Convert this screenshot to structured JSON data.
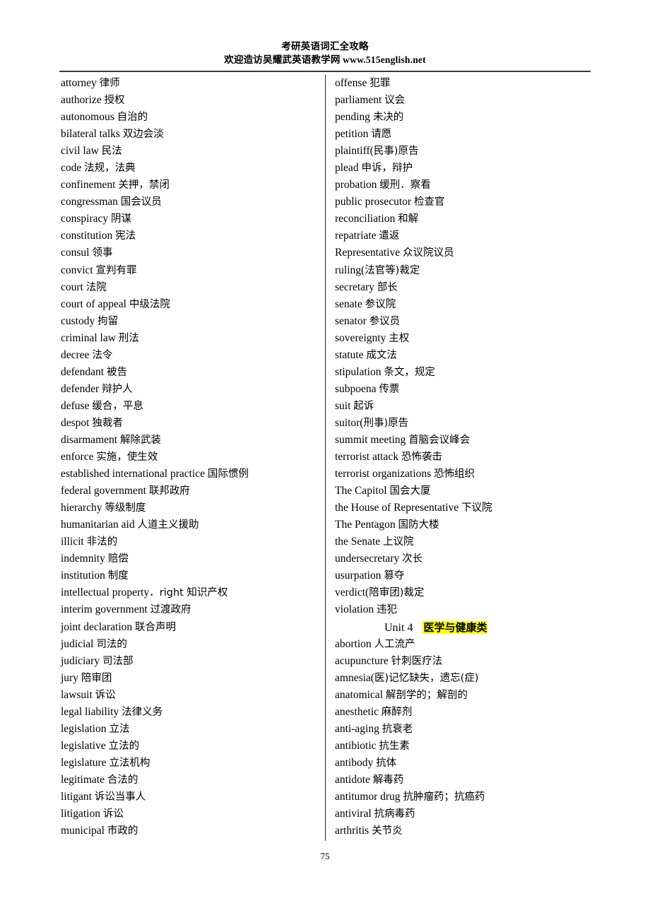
{
  "header": {
    "title_line1": "考研英语词汇全攻略",
    "title_line2": "欢迎造访吴耀武英语教学网 www.515english.net"
  },
  "footer": {
    "page_number": "75"
  },
  "unit_heading": {
    "label": "Unit 4",
    "topic": "医学与健康类",
    "highlight_color": "#ffff00"
  },
  "left_column": {
    "entries": [
      "attorney 律师",
      "authorize 授权",
      "autonomous 自治的",
      "bilateral talks 双边会淡",
      "civil law 民法",
      "code 法规，法典",
      "confinement 关押，禁闭",
      "congressman 国会议员",
      "conspiracy 阴谋",
      "constitution 宪法",
      "consul 领事",
      "convict 宣判有罪",
      "court 法院",
      "court of appeal 中级法院",
      "custody 拘留",
      "criminal law 刑法",
      "decree 法令",
      "defendant 被告",
      "defender 辩护人",
      "defuse 缓合，平息",
      "despot 独裁者",
      "disarmament 解除武装",
      "enforce 实施，使生效",
      "established international practice 国际惯例",
      "federal government 联邦政府",
      "hierarchy 等级制度",
      "humanitarian aid 人道主义援助",
      "illicit 非法的",
      "indemnity 赔偿",
      "institution 制度",
      "intellectual property．right 知识产权",
      "interim government 过渡政府",
      "joint declaration 联合声明",
      "judicial 司法的",
      "judiciary 司法部",
      "jury 陪审团",
      "lawsuit 诉讼",
      "legal liability 法律义务",
      "legislation 立法",
      "legislative 立法的",
      "legislature 立法机构",
      "legitimate 合法的",
      "litigant 诉讼当事人",
      "litigation 诉讼",
      "municipal 市政的"
    ]
  },
  "right_column": {
    "entries_before_unit": [
      "offense 犯罪",
      "parliament 议会",
      "pending 未决的",
      "petition 请愿",
      "plaintiff(民事)原告",
      "plead 申诉，辩护",
      "probation 缓刑．察看",
      "public prosecutor 检查官",
      "reconciliation 和解",
      "repatriate 遣返",
      "Representative 众议院议员",
      "ruling(法官等)裁定",
      "secretary 部长",
      "senate 参议院",
      "senator 参议员",
      "sovereignty 主权",
      "statute 成文法",
      "stipulation 条文，规定",
      "subpoena 传票",
      "suit 起诉",
      "suitor(刑事)原告",
      "summit meeting 首脑会议峰会",
      "terrorist attack 恐怖袭击",
      "terrorist organizations 恐怖组织",
      "The Capitol 国会大厦",
      "the House of Representative 下议院",
      "The Pentagon 国防大楼",
      "the Senate 上议院",
      "undersecretary 次长",
      "usurpation 篡夺",
      "verdict(陪审团)裁定",
      "violation 违犯"
    ],
    "entries_after_unit": [
      "abortion 人工流产",
      "acupuncture 针刺医疗法",
      "amnesia(医)记忆缺失，遗忘(症)",
      "anatomical 解剖学的；解剖的",
      "anesthetic 麻醉剂",
      "anti-aging 抗衰老",
      "antibiotic 抗生素",
      "antibody 抗体",
      "antidote 解毒药",
      "antitumor drug 抗肿瘤药；抗癌药",
      "antiviral 抗病毒药",
      "arthritis 关节炎"
    ]
  }
}
